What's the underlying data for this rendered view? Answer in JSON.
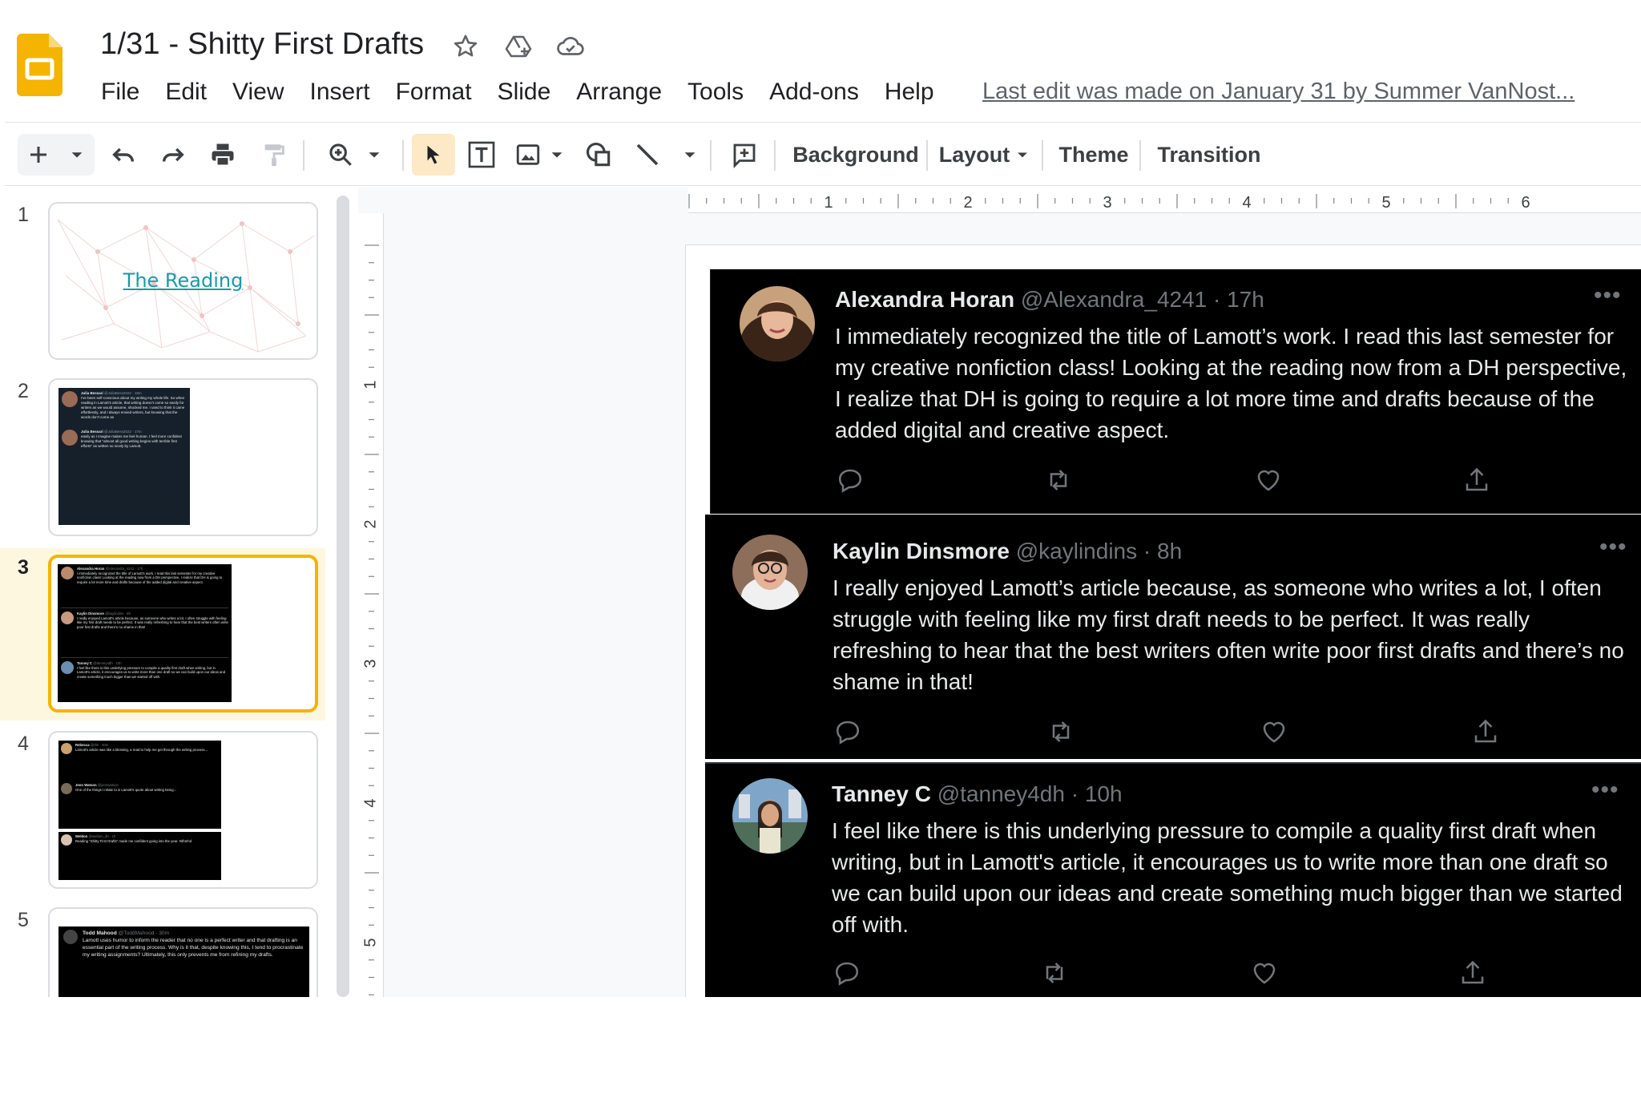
{
  "app": {
    "doc_title": "1/31 - Shitty First Drafts",
    "menu": [
      "File",
      "Edit",
      "View",
      "Insert",
      "Format",
      "Slide",
      "Arrange",
      "Tools",
      "Add-ons",
      "Help"
    ],
    "last_edit": "Last edit was made on January 31 by Summer VanNost..."
  },
  "toolbar": {
    "background": "Background",
    "layout": "Layout",
    "theme": "Theme",
    "transition": "Transition"
  },
  "rulers": {
    "horizontal_labels": [
      "1",
      "2",
      "3",
      "4",
      "5",
      "6"
    ],
    "vertical_labels": [
      "1",
      "2",
      "3",
      "4",
      "5"
    ]
  },
  "filmstrip": {
    "slides": [
      {
        "number": "1",
        "title": "The Reading"
      },
      {
        "number": "2",
        "tweets": [
          {
            "name": "Julia Bessari",
            "meta": "@JuliaBess2022 · 18m",
            "text": "I've been self-conscious about my writing my whole life. So when reading in Lamott's article, that writing doesn't come so easily for writers as we would assume, shocked me. I used to think it came effortlessly, and I always envied writers, but knowing that the words don't come as"
          },
          {
            "name": "Julia Bessari",
            "meta": "@JuliaBess2022 · 17m",
            "text": "easily as I imagine makes me feel human. I feel more confident knowing that \"almost all good writing begins with terrible first efforts\" as written so nicely by Lamott."
          }
        ]
      },
      {
        "number": "3"
      },
      {
        "number": "4",
        "tweets": [
          {
            "name": "Rebecca",
            "meta": "@rbk · 40m",
            "text": "Lamott's article was like a blessing, a read to help me get through the writing process..."
          },
          {
            "name": "Jenn Watson",
            "meta": "@jennwatson",
            "text": "One of the things I relate to is Lamott's quote about writing being..."
          },
          {
            "name": "Weldon",
            "meta": "@weldon_dh · 1h",
            "text": "Reading \"Shitty First Drafts\" made me confident going into the year. #dhmhd"
          }
        ]
      },
      {
        "number": "5",
        "tweets": [
          {
            "name": "Todd Mahood",
            "meta": "@ToddMahood · 30m",
            "text": "Lamott uses humor to inform the reader that no one is a perfect writer and that drafting is an essential part of the writing process. Why is it that, despite knowing this, I tend to procrastinate my writing assignments? Ultimately, this only prevents me from refining my drafts."
          }
        ]
      }
    ]
  },
  "tweets": [
    {
      "name": "Alexandra Horan",
      "meta": "@Alexandra_4241 · 17h",
      "text": "I immediately recognized the title of Lamott’s work. I read this last semester for my creative nonfiction class! Looking at the reading now from a DH perspective, I realize that DH is going to require a lot more time and drafts because of the added digital and creative aspect."
    },
    {
      "name": "Kaylin Dinsmore",
      "meta": "@kaylindins · 8h",
      "text": "I really enjoyed Lamott’s article because, as someone who writes a lot, I often struggle with feeling like my first draft needs to be perfect. It was really refreshing to hear that the best writers often write poor first drafts and there’s no shame in that!"
    },
    {
      "name": "Tanney C",
      "meta": "@tanney4dh · 10h",
      "text": "I feel like there is this underlying pressure to compile a quality first draft when writing, but in Lamott's article, it encourages us to write more than one draft so we can build upon our ideas and create something much bigger than we started off with."
    }
  ],
  "colors": {
    "accent": "#f4b400",
    "tweet_bg": "#000000",
    "tweet_text": "#e7e9ea",
    "tweet_meta": "#71767b",
    "link_teal": "#1a9aa8"
  }
}
